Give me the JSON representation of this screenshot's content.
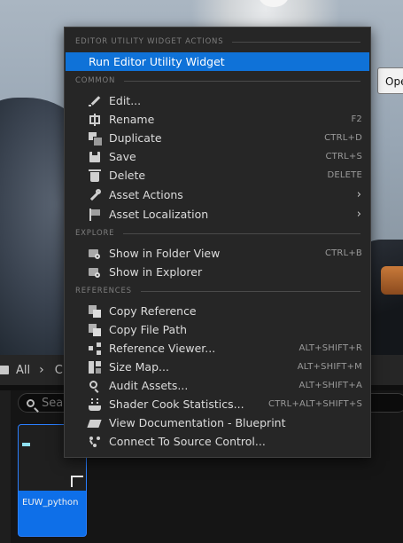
{
  "tooltip": {
    "text": "Ope"
  },
  "content_browser": {
    "path": [
      "All",
      "C"
    ],
    "search_placeholder": "Sear",
    "asset": {
      "name": "EUW_python"
    }
  },
  "context_menu": {
    "sections": {
      "euw_actions": "EDITOR UTILITY WIDGET ACTIONS",
      "common": "COMMON",
      "explore": "EXPLORE",
      "references": "REFERENCES"
    },
    "items": {
      "run_euw": {
        "label": "Run Editor Utility Widget",
        "shortcut": ""
      },
      "edit": {
        "label": "Edit...",
        "shortcut": ""
      },
      "rename": {
        "label": "Rename",
        "shortcut": "F2"
      },
      "duplicate": {
        "label": "Duplicate",
        "shortcut": "CTRL+D"
      },
      "save": {
        "label": "Save",
        "shortcut": "CTRL+S"
      },
      "delete": {
        "label": "Delete",
        "shortcut": "DELETE"
      },
      "asset_actions": {
        "label": "Asset Actions",
        "submenu": "›"
      },
      "asset_loc": {
        "label": "Asset Localization",
        "submenu": "›"
      },
      "show_folder": {
        "label": "Show in Folder View",
        "shortcut": "CTRL+B"
      },
      "show_explorer": {
        "label": "Show in Explorer",
        "shortcut": ""
      },
      "copy_ref": {
        "label": "Copy Reference",
        "shortcut": ""
      },
      "copy_path": {
        "label": "Copy File Path",
        "shortcut": ""
      },
      "ref_viewer": {
        "label": "Reference Viewer...",
        "shortcut": "ALT+SHIFT+R"
      },
      "size_map": {
        "label": "Size Map...",
        "shortcut": "ALT+SHIFT+M"
      },
      "audit": {
        "label": "Audit Assets...",
        "shortcut": "ALT+SHIFT+A"
      },
      "shader_stats": {
        "label": "Shader Cook Statistics...",
        "shortcut": "CTRL+ALT+SHIFT+S"
      },
      "view_docs": {
        "label": "View Documentation - Blueprint",
        "shortcut": ""
      },
      "source_control": {
        "label": "Connect To Source Control...",
        "shortcut": ""
      }
    }
  },
  "colors": {
    "selection": "#0f72d8",
    "menu_bg": "#262626",
    "asset_tile": "#0e6fe8"
  }
}
